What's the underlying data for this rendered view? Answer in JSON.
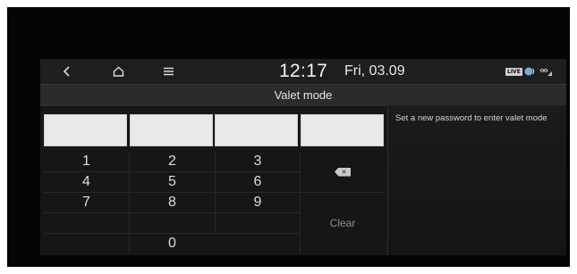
{
  "status": {
    "time": "12:17",
    "date": "Fri, 03.09",
    "live_label": "LIVE",
    "icons": [
      "back-icon",
      "home-icon",
      "menu-icon",
      "live-badge-icon",
      "voice-icon",
      "connection-icon"
    ]
  },
  "screen": {
    "title": "Valet mode",
    "hint": "Set a new password to enter valet mode"
  },
  "password_fields": [
    "",
    "",
    "",
    ""
  ],
  "keypad": {
    "digits": [
      "1",
      "2",
      "3",
      "4",
      "5",
      "6",
      "7",
      "8",
      "9",
      "0"
    ],
    "backspace_label": "⌫",
    "clear_label": "Clear"
  },
  "colors": {
    "screen_bg": "#151617",
    "titlebar_bg": "#2a2b2d",
    "field_bg": "#e9e9ea",
    "text": "#dcdcdc"
  }
}
